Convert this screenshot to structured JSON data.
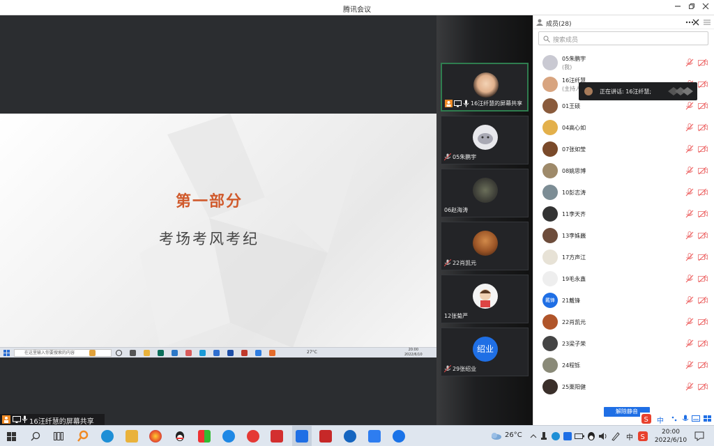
{
  "window": {
    "title": "腾讯会议"
  },
  "slide": {
    "title": "第一部分",
    "subtitle": "考场考风考纪"
  },
  "inner_taskbar": {
    "search_placeholder": "在这里输入你要搜索的内容",
    "temp": "27°C",
    "time": "20:00",
    "date": "2022/6/10"
  },
  "tiles": [
    {
      "name": "16汪纤慧的屏幕共享"
    },
    {
      "name": "05朱鹏宇"
    },
    {
      "name": "06赵海涛"
    },
    {
      "name": "22肖凯元"
    },
    {
      "name": "12张菊严"
    },
    {
      "name": "29张绍业",
      "avatar_text": "绍业"
    }
  ],
  "members_panel": {
    "title": "成员(28)",
    "search_placeholder": "搜索成员",
    "speaking": "正在讲话: 16汪纤慧;",
    "unmute_label": "解除静音",
    "members": [
      {
        "name": "05朱鹏宇",
        "sub": "(我)"
      },
      {
        "name": "16汪纤慧",
        "sub": "(主持人"
      },
      {
        "name": "01王硕"
      },
      {
        "name": "04高心如"
      },
      {
        "name": "07张如莹"
      },
      {
        "name": "08姚思博"
      },
      {
        "name": "10彭志涛"
      },
      {
        "name": "11李天齐"
      },
      {
        "name": "13李姝巍"
      },
      {
        "name": "17方声江"
      },
      {
        "name": "19毛永鑫"
      },
      {
        "name": "21戴锋",
        "avatar_text": "戴锋"
      },
      {
        "name": "22肖凯元"
      },
      {
        "name": "23梁子荣"
      },
      {
        "name": "24程铄"
      },
      {
        "name": "25栗阳健"
      }
    ]
  },
  "share_bar": {
    "label": "16汪纤慧的屏幕共享"
  },
  "taskbar": {
    "temp": "26°C",
    "ime_lang": "中",
    "time": "20:00",
    "date": "2022/6/10"
  },
  "colors": {
    "accent_blue": "#1f6fe5",
    "slide_title": "#d05a2c",
    "active_tile_border": "#2f7d4f"
  }
}
